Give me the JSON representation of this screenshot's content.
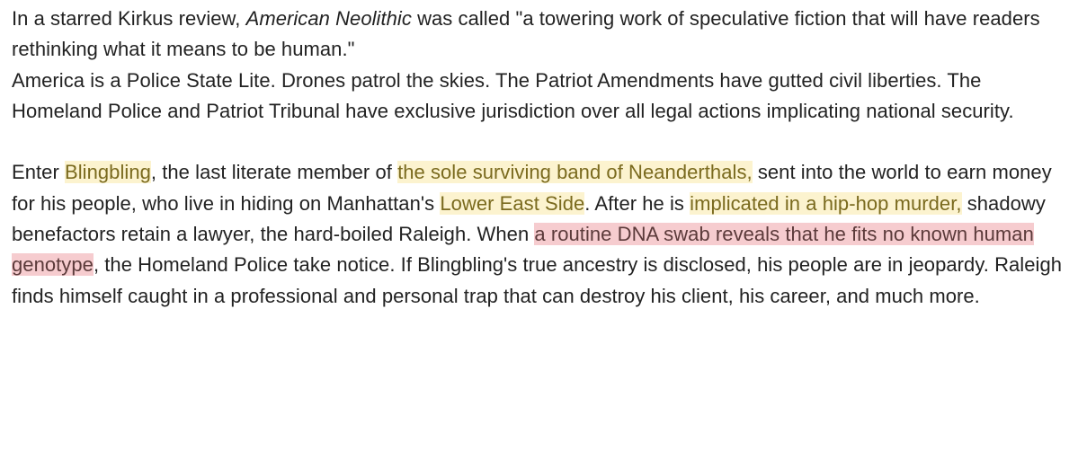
{
  "paragraph1": {
    "s1_pre": "In a starred Kirkus review, ",
    "s1_title": "American Neolithic",
    "s1_post": " was called \"a towering work of speculative fiction that will have readers rethinking what it means to be human.\""
  },
  "paragraph2": {
    "text": "America is a Police State Lite.   Drones patrol the skies. The Patriot Amendments have gutted civil liberties. The Homeland Police and Patriot Tribunal have exclusive jurisdiction over all legal actions implicating national security."
  },
  "paragraph3": {
    "t1": "Enter ",
    "h1": "Blingbling",
    "t2": ", the last literate member of ",
    "h2": "the sole surviving band of Neanderthals,",
    "t3": "  sent into the world to earn money for his people, who live in hiding on Manhattan's ",
    "h3": "Lower East Side",
    "t4": ".  After he is ",
    "h4": "implicated in a hip-hop murder,",
    "t5": " shadowy benefactors retain a lawyer, the hard-boiled Raleigh. When ",
    "h5": "a routine DNA swab reveals that he fits no known human genotype",
    "t6": ", the Homeland Police take notice.  If Blingbling's true ancestry is disclosed, his people are in jeopardy.  Raleigh finds himself caught in a professional and personal trap that can destroy his client, his career, and much more."
  },
  "colors": {
    "text": "#222222",
    "highlight_yellow": "#fcf3cf",
    "highlight_red": "#f6cccf"
  }
}
